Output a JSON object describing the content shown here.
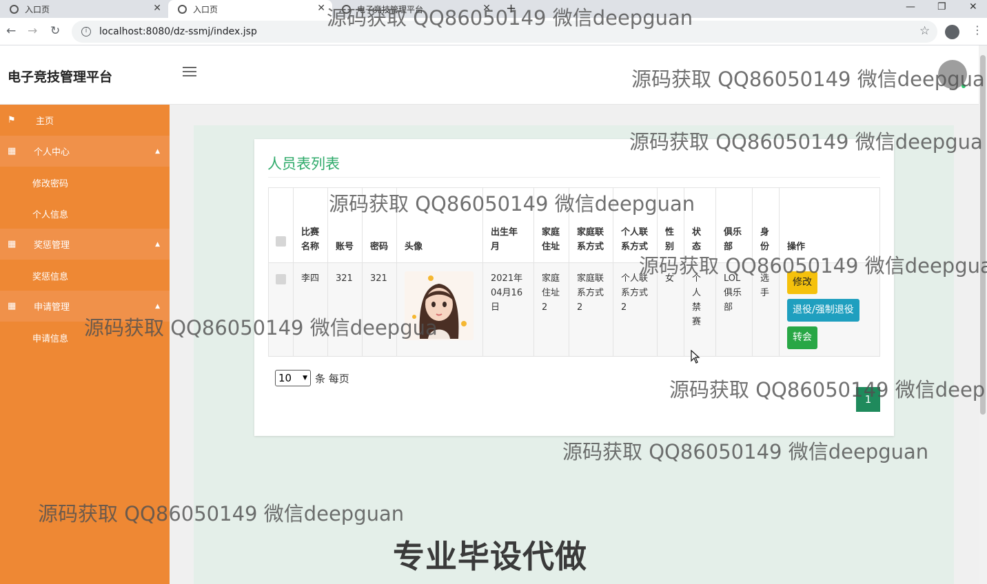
{
  "browser": {
    "tabs": [
      {
        "title": "入口页"
      },
      {
        "title": "入口页"
      },
      {
        "title": "电子竞技管理平台"
      }
    ],
    "url": "localhost:8080/dz-ssmj/index.jsp"
  },
  "header": {
    "brand": "电子竞技管理平台"
  },
  "sidebar": {
    "items": [
      {
        "label": "主页",
        "icon": "flag-icon"
      },
      {
        "label": "个人中心",
        "icon": "grid-icon",
        "children": [
          "修改密码",
          "个人信息"
        ]
      },
      {
        "label": "奖惩管理",
        "icon": "grid-icon",
        "children": [
          "奖惩信息"
        ]
      },
      {
        "label": "申请管理",
        "icon": "grid-icon",
        "children": [
          "申请信息"
        ]
      }
    ]
  },
  "main": {
    "title": "人员表列表",
    "columns": [
      "比赛名称",
      "账号",
      "密码",
      "头像",
      "出生年月",
      "家庭住址",
      "家庭联系方式",
      "个人联系方式",
      "性别",
      "状态",
      "俱乐部",
      "身份",
      "操作"
    ],
    "rows": [
      {
        "name": "李四",
        "account": "321",
        "password": "321",
        "birth": "2021年04月16日",
        "address": "家庭住址2",
        "home_contact": "家庭联系方式2",
        "personal_contact": "个人联系方式2",
        "gender": "女",
        "status": "个人禁赛",
        "club": "LOL俱乐部",
        "identity": "选手"
      }
    ],
    "actions": {
      "edit": "修改",
      "retire": "退役/强制退役",
      "transfer": "转会"
    },
    "pagination": {
      "page_size": "10",
      "page_size_suffix": "条 每页",
      "current_page": "1"
    }
  },
  "watermarks": {
    "text": "源码获取 QQ86050149 微信deepguan",
    "text_cut1": "源码获取 QQ86050149 微信deepgua",
    "text_cut2": "源码获取 QQ86050149 微信deepguan",
    "text_cut3": "源码获取 QQ86050149 微信deep",
    "banner": "专业毕设代做"
  },
  "colors": {
    "sidebar": "#ee8834",
    "title_green": "#2eaa6a",
    "btn_edit": "#f5c10c",
    "btn_retire": "#1f9fbf",
    "btn_transfer": "#28a745",
    "page_active": "#1f8a5c"
  }
}
